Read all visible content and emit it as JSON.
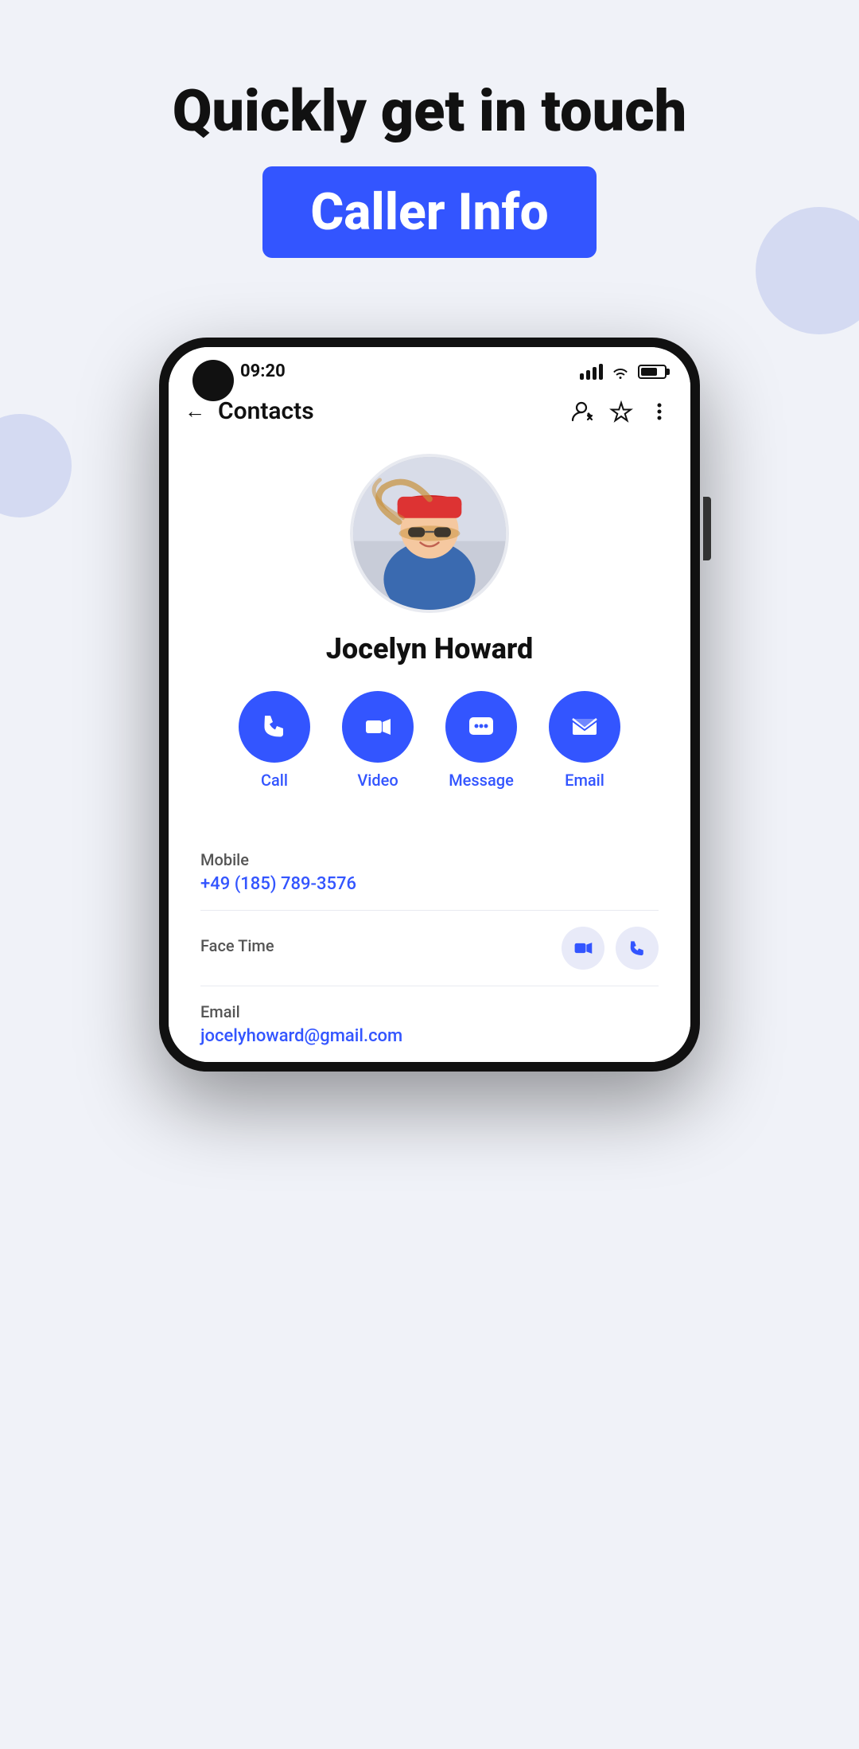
{
  "page": {
    "background_color": "#f0f2f8",
    "title": "Quickly get in touch",
    "badge": "Caller Info"
  },
  "phone": {
    "status_bar": {
      "time": "09:20",
      "signal": "signal-bars-icon",
      "wifi": "wifi-icon",
      "battery": "battery-icon"
    },
    "app_bar": {
      "back": "←",
      "title": "Contacts",
      "icons": [
        "person-edit-icon",
        "star-icon",
        "more-icon"
      ]
    },
    "contact": {
      "name": "Jocelyn Howard",
      "avatar_alt": "Jocelyn Howard photo"
    },
    "actions": [
      {
        "id": "call",
        "label": "Call"
      },
      {
        "id": "video",
        "label": "Video"
      },
      {
        "id": "message",
        "label": "Message"
      },
      {
        "id": "email",
        "label": "Email"
      }
    ],
    "info_rows": [
      {
        "type": "simple",
        "label": "Mobile",
        "value": "+49 (185) 789-3576"
      },
      {
        "type": "facetime",
        "label": "Face Time"
      },
      {
        "type": "simple",
        "label": "Email",
        "value": "jocelyhoward@gmail.com"
      }
    ]
  },
  "colors": {
    "accent": "#3355ff",
    "text_primary": "#111111",
    "text_secondary": "#555555",
    "bg_light": "#f0f2f8",
    "white": "#ffffff"
  }
}
